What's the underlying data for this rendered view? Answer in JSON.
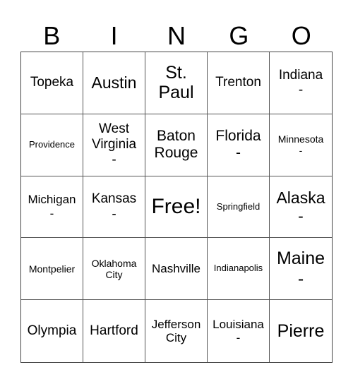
{
  "header": {
    "letters": [
      "B",
      "I",
      "N",
      "G",
      "O"
    ]
  },
  "grid": {
    "rows": [
      [
        "Topeka",
        "Austin",
        "St.\nPaul",
        "Trenton",
        "Indiana\n-"
      ],
      [
        "Providence",
        "West\nVirginia\n-",
        "Baton\nRouge",
        "Florida\n-",
        "Minnesota\n-"
      ],
      [
        "Michigan\n-",
        "Kansas\n-",
        "Free!",
        "Springfield",
        "Alaska\n-"
      ],
      [
        "Montpelier",
        "Oklahoma\nCity",
        "Nashville",
        "Indianapolis",
        "Maine\n-"
      ],
      [
        "Olympia",
        "Hartford",
        "Jefferson\nCity",
        "Louisiana\n-",
        "Pierre"
      ]
    ]
  }
}
